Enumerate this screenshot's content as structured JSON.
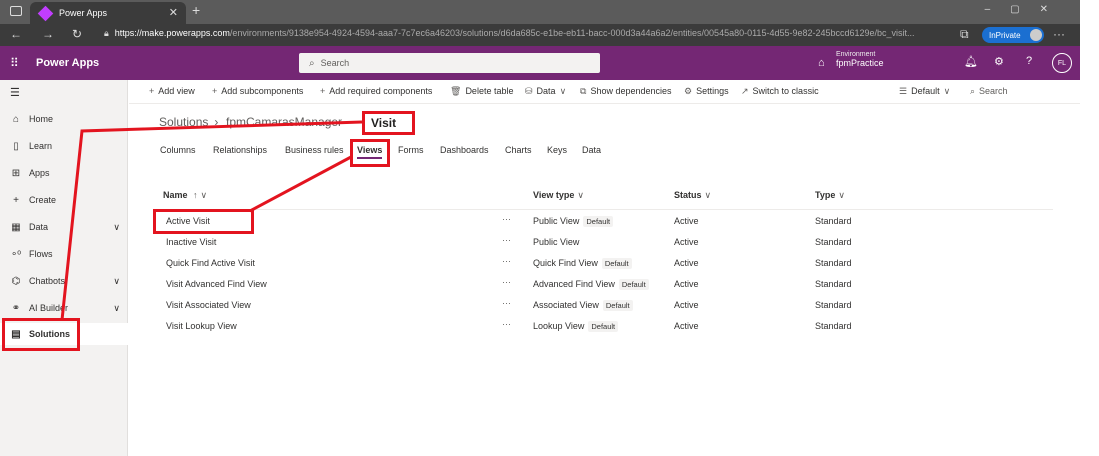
{
  "browser": {
    "tab_title": "Power Apps",
    "url_host": "https://make.powerapps.com",
    "url_rest": "/environments/9138e954-4924-4594-aaa7-7c7ec6a46203/solutions/d6da685c-e1be-eb11-bacc-000d3a44a6a2/entities/00545a80-0115-4d55-9e82-245bccd6129e/bc_visit...",
    "inprivate_label": "InPrivate"
  },
  "header": {
    "app_name": "Power Apps",
    "search_placeholder": "Search",
    "env_label": "Environment",
    "env_name": "fpmPractice",
    "user_initials": "FL"
  },
  "leftnav": {
    "items": [
      {
        "label": "Home",
        "icon": "home-icon"
      },
      {
        "label": "Learn",
        "icon": "book-icon"
      },
      {
        "label": "Apps",
        "icon": "apps-icon"
      },
      {
        "label": "Create",
        "icon": "plus-icon"
      },
      {
        "label": "Data",
        "icon": "table-icon"
      },
      {
        "label": "Flows",
        "icon": "flow-icon"
      },
      {
        "label": "Chatbots",
        "icon": "chatbot-icon"
      },
      {
        "label": "AI Builder",
        "icon": "ai-builder-icon"
      },
      {
        "label": "Solutions",
        "icon": "solutions-icon"
      }
    ]
  },
  "commandbar": {
    "add_view": "Add view",
    "add_subcomponents": "Add subcomponents",
    "add_required": "Add required components",
    "delete_table": "Delete table",
    "data": "Data",
    "show_dependencies": "Show dependencies",
    "settings": "Settings",
    "switch_classic": "Switch to classic",
    "default_view": "Default",
    "search": "Search"
  },
  "breadcrumb": {
    "solutions": "Solutions",
    "solution_name": "fpmCamarasManager",
    "current": "Visit"
  },
  "tabs": [
    "Columns",
    "Relationships",
    "Business rules",
    "Views",
    "Forms",
    "Dashboards",
    "Charts",
    "Keys",
    "Data"
  ],
  "table": {
    "columns": [
      "Name",
      "View type",
      "Status",
      "Type"
    ],
    "name_sort_indicator": "↑",
    "rows": [
      {
        "name": "Active Visit",
        "view_type": "Public View",
        "default": "Default",
        "status": "Active",
        "type": "Standard"
      },
      {
        "name": "Inactive Visit",
        "view_type": "Public View",
        "default": "",
        "status": "Active",
        "type": "Standard"
      },
      {
        "name": "Quick Find Active Visit",
        "view_type": "Quick Find View",
        "default": "Default",
        "status": "Active",
        "type": "Standard"
      },
      {
        "name": "Visit Advanced Find View",
        "view_type": "Advanced Find View",
        "default": "Default",
        "status": "Active",
        "type": "Standard"
      },
      {
        "name": "Visit Associated View",
        "view_type": "Associated View",
        "default": "Default",
        "status": "Active",
        "type": "Standard"
      },
      {
        "name": "Visit Lookup View",
        "view_type": "Lookup View",
        "default": "Default",
        "status": "Active",
        "type": "Standard"
      }
    ]
  },
  "colors": {
    "brand": "#742774",
    "annotation": "#e3141f"
  }
}
